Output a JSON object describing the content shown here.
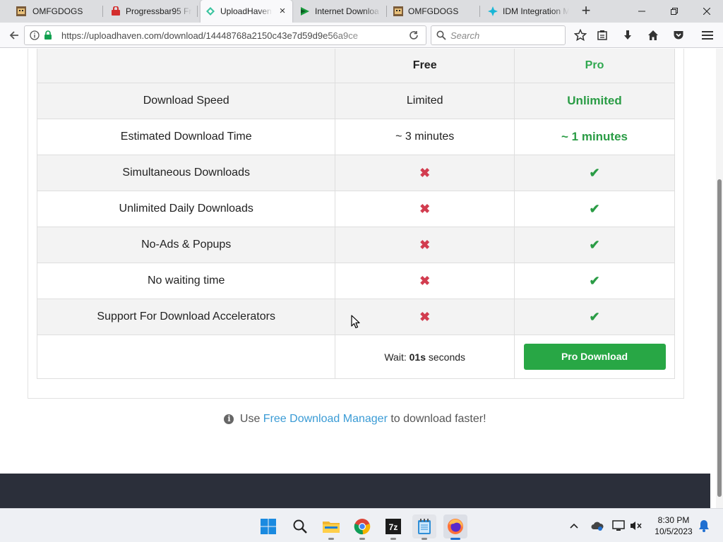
{
  "browser": {
    "tabs": [
      {
        "title": "OMFGDOGS",
        "icon": "dog-favicon-icon"
      },
      {
        "title": "Progressbar95 Fr",
        "icon": "progressbar-favicon-icon"
      },
      {
        "title": "UploadHaven",
        "icon": "uploadhaven-favicon-icon",
        "active": true
      },
      {
        "title": "Internet Downloa",
        "icon": "idm-favicon-icon"
      },
      {
        "title": "OMFGDOGS",
        "icon": "dog-favicon-icon"
      },
      {
        "title": "IDM Integration M",
        "icon": "idm-integration-favicon-icon"
      }
    ],
    "url": "https://uploadhaven.com/download/14448768a2150c43e7d59d9e56a9ce",
    "search_placeholder": "Search"
  },
  "comparison": {
    "headers": {
      "feature": "",
      "free": "Free",
      "pro": "Pro"
    },
    "rows": [
      {
        "feature": "Download Speed",
        "free": "Limited",
        "pro": "Unlimited"
      },
      {
        "feature": "Estimated Download Time",
        "free": "~ 3 minutes",
        "pro": "~ 1 minutes"
      },
      {
        "feature": "Simultaneous Downloads",
        "free": "✖",
        "pro": "✔"
      },
      {
        "feature": "Unlimited Daily Downloads",
        "free": "✖",
        "pro": "✔"
      },
      {
        "feature": "No-Ads & Popups",
        "free": "✖",
        "pro": "✔"
      },
      {
        "feature": "No waiting time",
        "free": "✖",
        "pro": "✔"
      },
      {
        "feature": "Support For Download Accelerators",
        "free": "✖",
        "pro": "✔"
      }
    ],
    "wait_prefix": "Wait:",
    "wait_value": "01s",
    "wait_suffix": "seconds",
    "pro_button": "Pro Download"
  },
  "tip": {
    "prefix": "Use",
    "link": "Free Download Manager",
    "suffix": "to download faster!"
  },
  "taskbar": {
    "time": "8:30 PM",
    "date": "10/5/2023"
  },
  "colors": {
    "pro_green": "#28a745",
    "cross_red": "#d23c4f",
    "link_blue": "#3a9bd5",
    "footer_dark": "#2b2f3a"
  }
}
